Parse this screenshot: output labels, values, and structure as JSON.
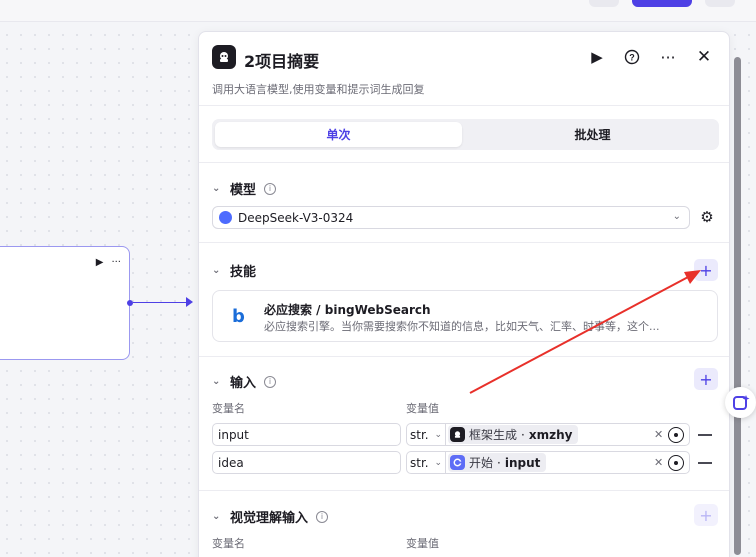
{
  "node_panel": {
    "title": "2项目摘要",
    "description": "调用大语言模型,使用变量和提示词生成回复",
    "tabs": [
      {
        "label": "单次",
        "active": true
      },
      {
        "label": "批处理",
        "active": false
      }
    ],
    "model_section": {
      "title": "模型",
      "selected_model": "DeepSeek-V3-0324"
    },
    "skills_section": {
      "title": "技能",
      "skills": [
        {
          "name": "必应搜索 / bingWebSearch",
          "description": "必应搜索引擎。当你需要搜索你不知道的信息，比如天气、汇率、时事等，这个..."
        }
      ]
    },
    "input_section": {
      "title": "输入",
      "col_name": "变量名",
      "col_value": "变量值",
      "rows": [
        {
          "name": "input",
          "type": "str.",
          "ref_node": "框架生成",
          "ref_var": "xmzhy"
        },
        {
          "name": "idea",
          "type": "str.",
          "ref_node": "开始",
          "ref_var": "input"
        }
      ]
    },
    "vision_section": {
      "title": "视觉理解输入",
      "col_name": "变量名",
      "col_value": "变量值"
    }
  },
  "icons": {
    "run": "play-icon",
    "help": "question-icon",
    "more": "more-icon",
    "close": "close-icon",
    "settings": "gear-icon",
    "add": "plus-icon",
    "remove": "minus-icon"
  },
  "colors": {
    "accent": "#4e40e5",
    "annotation_arrow": "#e8302a"
  }
}
